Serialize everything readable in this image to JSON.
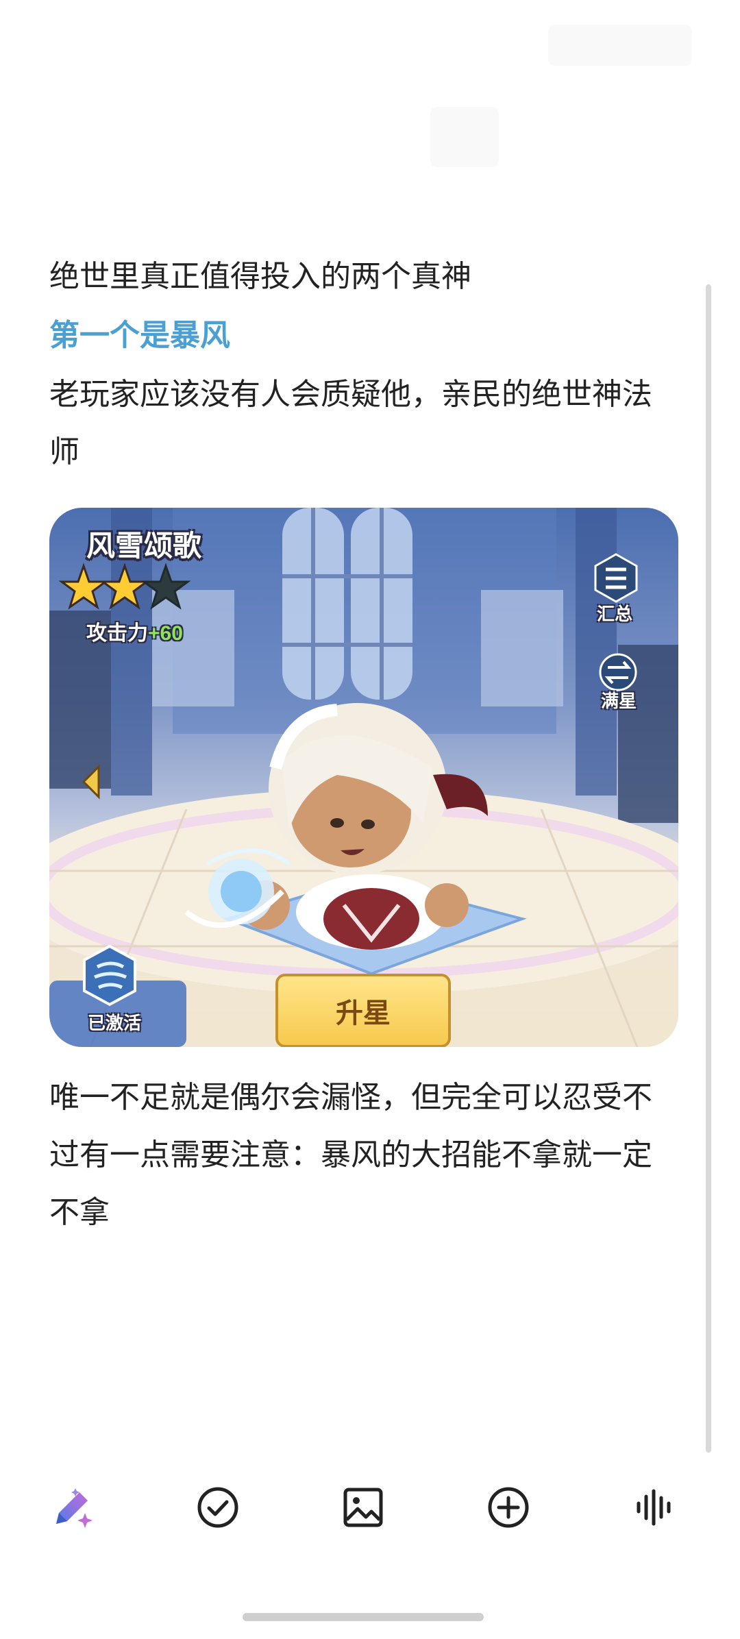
{
  "article": {
    "line1": "绝世里真正值得投入的两个真神",
    "line2": "第一个是暴风",
    "line3": "老玩家应该没有人会质疑他，亲民的绝世神法师",
    "para2": "唯一不足就是偶尔会漏怪，但完全可以忍受不过有一点需要注意：暴风的大招能不拿就一定不拿"
  },
  "game_image": {
    "title": "风雪颂歌",
    "stars": {
      "filled": 2,
      "total": 3
    },
    "attack_label": "攻击力",
    "attack_bonus": "+60",
    "summary_label": "汇总",
    "full_star_label": "满星",
    "activated_label": "已激活",
    "upgrade_button": "升星"
  },
  "toolbar": {
    "items": [
      "ai-pen-icon",
      "check-circle-icon",
      "image-icon",
      "add-circle-icon",
      "voice-wave-icon"
    ]
  },
  "colors": {
    "highlight_text": "#4a9fd3",
    "body_text": "#222222",
    "ai_pen_gradient": [
      "#4f7de8",
      "#c26bd9"
    ]
  }
}
